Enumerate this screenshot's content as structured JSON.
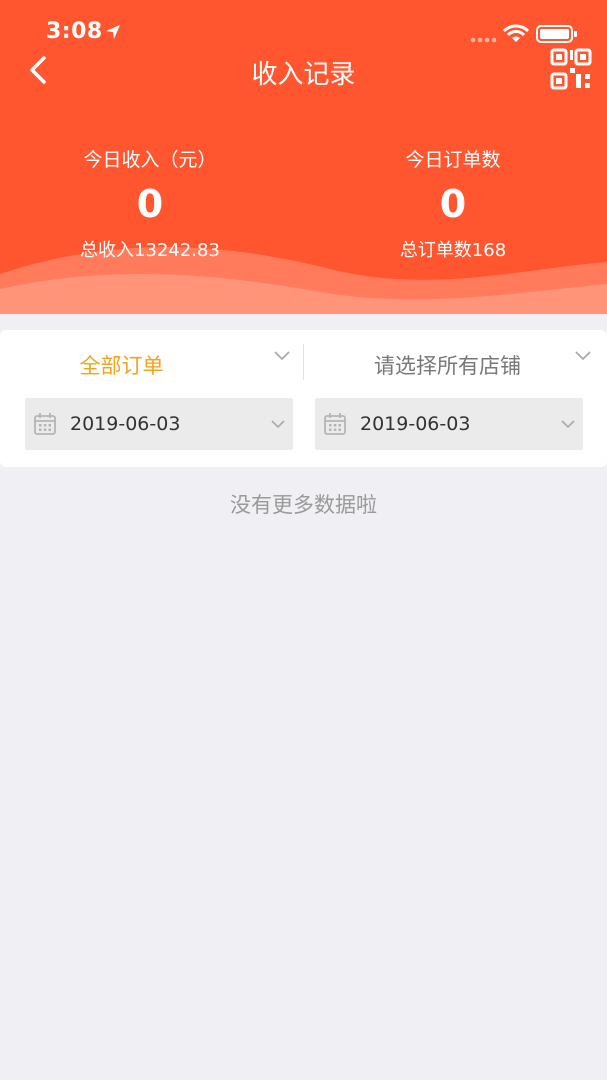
{
  "status_bar": {
    "time": "3:08"
  },
  "header": {
    "title": "收入记录",
    "today_income": {
      "label": "今日收入（元）",
      "value": "0",
      "total": "总收入13242.83"
    },
    "today_orders": {
      "label": "今日订单数",
      "value": "0",
      "total": "总订单数168"
    }
  },
  "filters": {
    "order_type": "全部订单",
    "store": "请选择所有店铺",
    "start_date": "2019-06-03",
    "end_date": "2019-06-03"
  },
  "empty_message": "没有更多数据啦",
  "colors": {
    "header_bg": "#ff5630",
    "active_filter": "#f5a21c",
    "page_bg": "#efeff4"
  }
}
